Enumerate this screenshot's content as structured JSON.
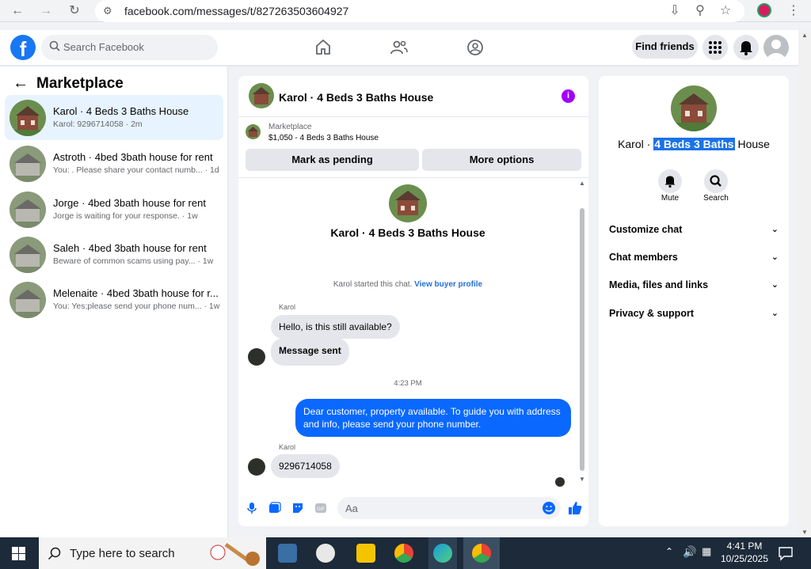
{
  "browser": {
    "url": "facebook.com/messages/t/827263503604927"
  },
  "topbar": {
    "search_placeholder": "Search Facebook",
    "find_friends": "Find friends"
  },
  "left": {
    "title": "Marketplace",
    "conversations": [
      {
        "name": "Karol · 4 Beds 3 Baths House",
        "preview": "Karol: 9296714058 · 2m"
      },
      {
        "name": "Astroth · 4bed 3bath house for rent",
        "preview": "You: . Please share your contact numb... · 1d"
      },
      {
        "name": "Jorge · 4bed 3bath house for rent",
        "preview": "Jorge is waiting for your response. · 1w"
      },
      {
        "name": "Saleh · 4bed 3bath house for rent",
        "preview": "Beware of common scams using pay... · 1w"
      },
      {
        "name": "Melenaite · 4bed 3bath house for r...",
        "preview": "You: Yes;please send your phone num... · 1w"
      }
    ]
  },
  "chat": {
    "title": "Karol · 4 Beds 3 Baths House",
    "marketplace_label": "Marketplace",
    "listing": "$1,050 - 4 Beds 3 Baths House",
    "mark_pending": "Mark as pending",
    "more_options": "More options",
    "profile_name": "Karol · 4 Beds 3 Baths House",
    "started_text": "Karol started this chat.",
    "view_buyer": "View buyer profile",
    "sender1": "Karol",
    "msg1": "Hello, is this still available?",
    "msg2": "Message sent",
    "time": "4:23 PM",
    "msg3": "Dear customer, property available. To guide you with address and info, please send your phone number.",
    "sender2": "Karol",
    "msg4": "9296714058",
    "composer_placeholder": "Aa"
  },
  "right": {
    "name_prefix": "Karol · ",
    "name_highlight": "4 Beds 3 Baths",
    "name_suffix": " House",
    "mute": "Mute",
    "search": "Search",
    "sections": [
      "Customize chat",
      "Chat members",
      "Media, files and links",
      "Privacy & support"
    ]
  },
  "taskbar": {
    "search_placeholder": "Type here to search",
    "time": "4:41 PM",
    "date": "10/25/2025"
  }
}
